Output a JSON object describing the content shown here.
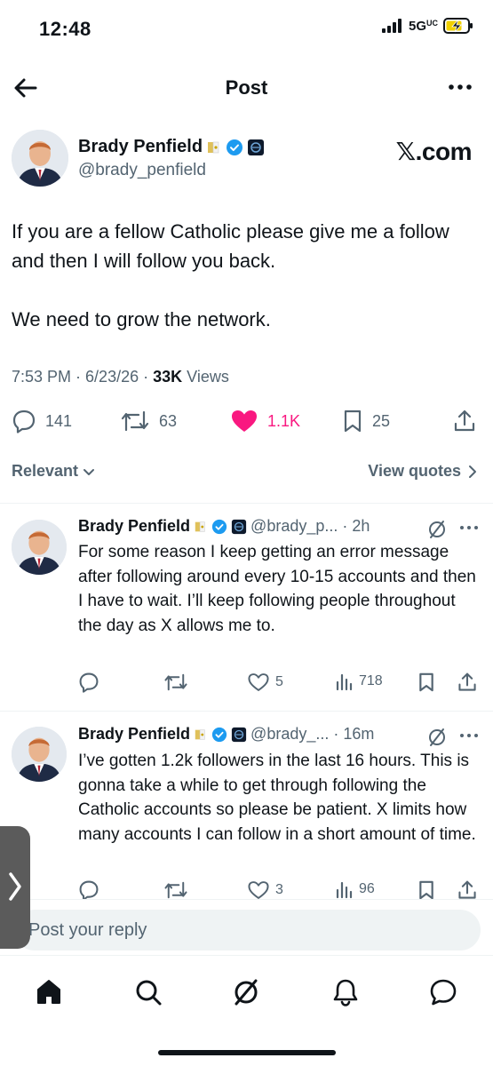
{
  "status_bar": {
    "time": "12:48",
    "network": "5G",
    "network_suffix": "UC"
  },
  "header": {
    "title": "Post"
  },
  "main_tweet": {
    "author_name": "Brady Penfield",
    "handle": "@brady_penfield",
    "watermark": "𝕏.com",
    "paragraphs": [
      "If you are a fellow Catholic please give me a follow and then I will follow you back.",
      "We need to grow the network."
    ],
    "time": "7:53 PM",
    "date": "6/23/26",
    "views_count": "33K",
    "views_label": "Views",
    "stats": {
      "replies": "141",
      "reposts": "63",
      "likes": "1.1K",
      "bookmarks": "25"
    }
  },
  "sort": {
    "label": "Relevant",
    "view_quotes": "View quotes"
  },
  "replies": [
    {
      "author_name": "Brady Penfield",
      "handle": "@brady_p...",
      "time": "2h",
      "text": "For some reason I keep getting an error message after following around every 10-15 accounts and then I have to wait. I’ll keep following people throughout the day as X allows me to.",
      "likes": "5",
      "views": "718"
    },
    {
      "author_name": "Brady Penfield",
      "handle": "@brady_...",
      "time": "16m",
      "text": "I’ve gotten 1.2k followers in the last 16 hours. This is gonna take a while to get through following the Catholic accounts so please be patient. X limits how many accounts I can follow in a short amount of time.",
      "likes": "3",
      "views": "96"
    }
  ],
  "composer": {
    "placeholder": "Post your reply"
  },
  "colors": {
    "verified": "#1d9bf0",
    "like": "#f91880",
    "secondary_text": "#536471"
  }
}
